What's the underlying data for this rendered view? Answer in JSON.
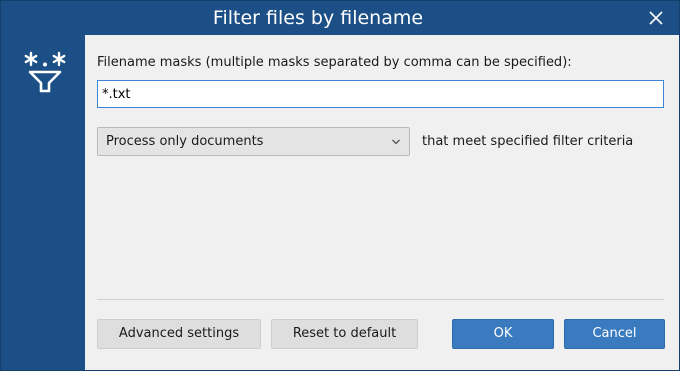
{
  "window": {
    "title": "Filter files by filename"
  },
  "form": {
    "mask_label": "Filename masks (multiple masks separated by comma can be specified):",
    "mask_value": "*.txt",
    "process_select_value": "Process only documents",
    "criteria_text": "that meet specified filter criteria"
  },
  "buttons": {
    "advanced_label": "Advanced settings",
    "reset_label": "Reset to default",
    "ok_label": "OK",
    "cancel_label": "Cancel"
  },
  "icons": {
    "close": "close-icon",
    "filter": "filter-mask-icon",
    "chevron": "chevron-down-icon"
  },
  "colors": {
    "title_bar": "#1c4f86",
    "content_bg": "#f0f0f0",
    "input_focus_border": "#3d86d6",
    "primary_button": "#3a7bc0"
  }
}
